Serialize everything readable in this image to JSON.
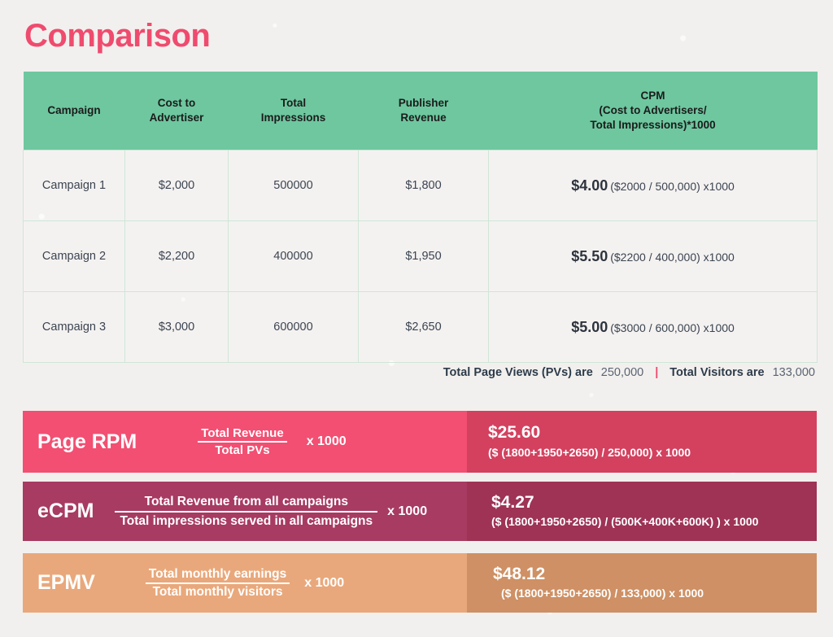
{
  "page": {
    "title": "Comparison",
    "accent_pink": "#ef4b6e",
    "header_green": "#6ec79f",
    "background": "#f2f0ee"
  },
  "table": {
    "headers": [
      "Campaign",
      "Cost to\nAdvertiser",
      "Total\nImpressions",
      "Publisher\nRevenue",
      "CPM\n(Cost to Advertisers/\nTotal Impressions)*1000"
    ],
    "headers_flat": {
      "campaign": "Campaign",
      "cost_line1": "Cost to",
      "cost_line2": "Advertiser",
      "impressions_line1": "Total",
      "impressions_line2": "Impressions",
      "revenue_line1": "Publisher",
      "revenue_line2": "Revenue",
      "cpm_line1": "CPM",
      "cpm_line2": "(Cost to Advertisers/",
      "cpm_line3": "Total Impressions)*1000"
    },
    "rows": [
      {
        "campaign": "Campaign 1",
        "cost": "$2,000",
        "impressions": "500000",
        "revenue": "$1,800",
        "cpm_value": "$4.00",
        "cpm_expression": "($2000 / 500,000) x1000"
      },
      {
        "campaign": "Campaign 2",
        "cost": "$2,200",
        "impressions": "400000",
        "revenue": "$1,950",
        "cpm_value": "$5.50",
        "cpm_expression": "($2200 / 400,000) x1000"
      },
      {
        "campaign": "Campaign 3",
        "cost": "$3,000",
        "impressions": "600000",
        "revenue": "$2,650",
        "cpm_value": "$5.00",
        "cpm_expression": "($3000 / 600,000) x1000"
      }
    ]
  },
  "totals": {
    "page_views_label": "Total Page Views (PVs)  are",
    "page_views_value": "250,000",
    "separator": "|",
    "visitors_label": "Total Visitors are",
    "visitors_value": "133,000"
  },
  "metrics": [
    {
      "name": "Page RPM",
      "numerator": "Total Revenue",
      "denominator": "Total PVs",
      "multiplier": "x 1000",
      "result_value": "$25.60",
      "result_expression": "($ (1800+1950+2650) / 250,000) x 1000",
      "color_left": "#f24f72",
      "color_right": "#d3415f"
    },
    {
      "name": "eCPM",
      "numerator": "Total Revenue from all campaigns",
      "denominator": "Total impressions served in all campaigns",
      "multiplier": "x 1000",
      "result_value": "$4.27",
      "result_expression": "($ (1800+1950+2650) / (500K+400K+600K) )  x 1000",
      "color_left": "#a73b62",
      "color_right": "#9e3356"
    },
    {
      "name": "EPMV",
      "numerator": "Total monthly earnings",
      "denominator": "Total monthly visitors",
      "multiplier": "x 1000",
      "result_value": "$48.12",
      "result_expression": "($ (1800+1950+2650) / 133,000) x 1000",
      "color_left": "#e9a87b",
      "color_right": "#ce9064"
    }
  ]
}
